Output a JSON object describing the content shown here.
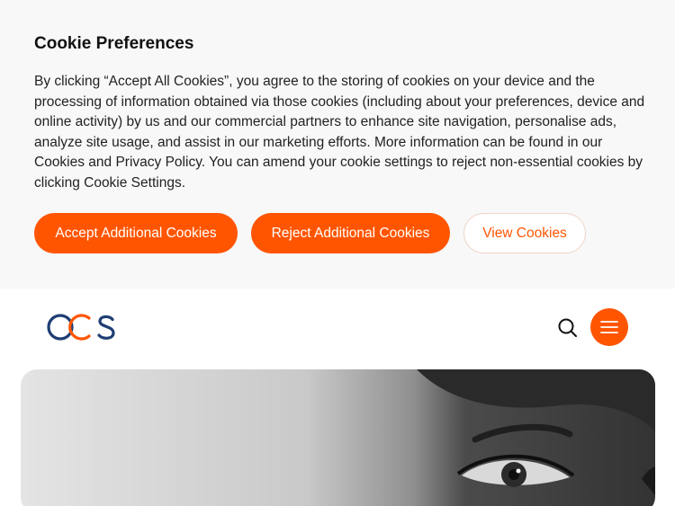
{
  "cookie_banner": {
    "title": "Cookie Preferences",
    "text": "By clicking “Accept All Cookies”, you agree to the storing of cookies on your device and the processing of information obtained via those cookies (including about your preferences, device and online activity) by us and our commercial partners to enhance site navigation, personalise ads, analyze site usage, and assist in our marketing efforts. More information can be found in our Cookies and Privacy Policy. You can amend your cookie settings to reject non-essential cookies by clicking Cookie Settings.",
    "accept_label": "Accept Additional Cookies",
    "reject_label": "Reject Additional Cookies",
    "view_label": "View Cookies"
  },
  "header": {
    "logo_text": "OCS",
    "search_icon": "search-icon",
    "menu_icon": "hamburger-menu-icon"
  },
  "colors": {
    "accent": "#ff5500",
    "logo_navy": "#1f3e73",
    "banner_bg": "#f8f8f8"
  }
}
